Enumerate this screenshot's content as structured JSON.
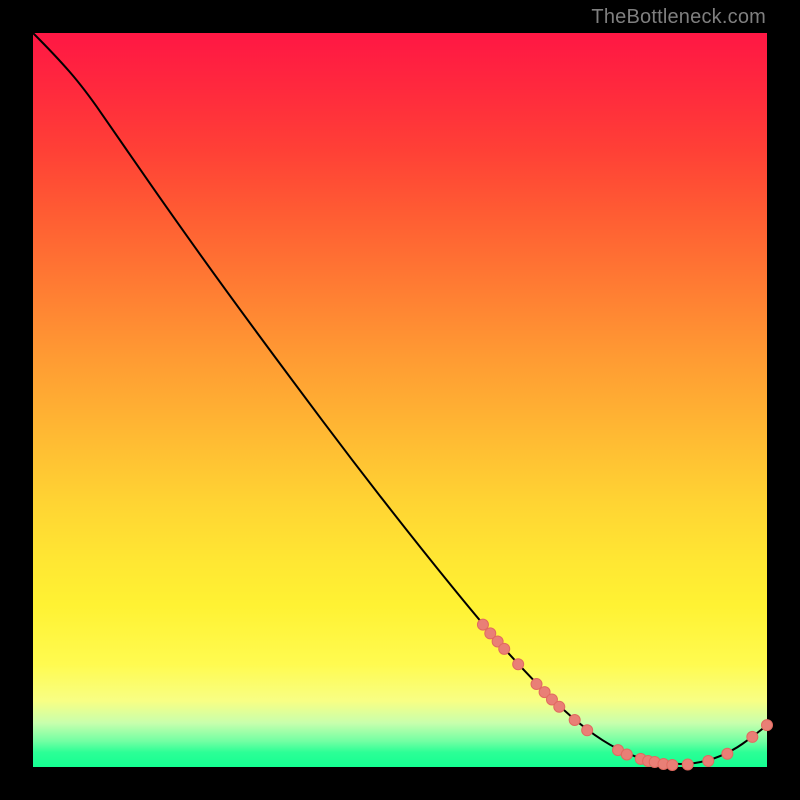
{
  "attribution": "TheBottleneck.com",
  "colors": {
    "dot_fill": "#e97f76",
    "dot_stroke": "#e16a60",
    "curve": "#000000"
  },
  "chart_data": {
    "type": "line",
    "title": "",
    "xlabel": "",
    "ylabel": "",
    "xlim": [
      0,
      100
    ],
    "ylim": [
      0,
      100
    ],
    "grid": false,
    "series": [
      {
        "name": "curve",
        "points": [
          {
            "x": 0.0,
            "y": 100.0
          },
          {
            "x": 3.0,
            "y": 97.0
          },
          {
            "x": 7.0,
            "y": 92.4
          },
          {
            "x": 11.5,
            "y": 85.9
          },
          {
            "x": 18.0,
            "y": 76.5
          },
          {
            "x": 26.0,
            "y": 65.3
          },
          {
            "x": 35.0,
            "y": 53.1
          },
          {
            "x": 44.0,
            "y": 41.1
          },
          {
            "x": 53.0,
            "y": 29.6
          },
          {
            "x": 61.3,
            "y": 19.4
          },
          {
            "x": 66.1,
            "y": 14.0
          },
          {
            "x": 71.0,
            "y": 8.9
          },
          {
            "x": 75.5,
            "y": 5.0
          },
          {
            "x": 79.7,
            "y": 2.3
          },
          {
            "x": 83.8,
            "y": 0.82
          },
          {
            "x": 88.4,
            "y": 0.27
          },
          {
            "x": 92.0,
            "y": 0.82
          },
          {
            "x": 95.3,
            "y": 2.2
          },
          {
            "x": 98.0,
            "y": 4.1
          },
          {
            "x": 100.0,
            "y": 5.7
          }
        ]
      }
    ],
    "markers": [
      {
        "x": 61.3,
        "y": 19.4,
        "r": 5.5
      },
      {
        "x": 62.3,
        "y": 18.2,
        "r": 5.5
      },
      {
        "x": 63.3,
        "y": 17.1,
        "r": 5.5
      },
      {
        "x": 64.2,
        "y": 16.1,
        "r": 5.5
      },
      {
        "x": 66.1,
        "y": 14.0,
        "r": 5.5
      },
      {
        "x": 68.6,
        "y": 11.3,
        "r": 5.5
      },
      {
        "x": 69.7,
        "y": 10.2,
        "r": 5.5
      },
      {
        "x": 70.7,
        "y": 9.2,
        "r": 5.5
      },
      {
        "x": 71.7,
        "y": 8.2,
        "r": 5.5
      },
      {
        "x": 73.8,
        "y": 6.4,
        "r": 5.5
      },
      {
        "x": 75.5,
        "y": 5.0,
        "r": 5.5
      },
      {
        "x": 79.7,
        "y": 2.3,
        "r": 5.5
      },
      {
        "x": 80.9,
        "y": 1.7,
        "r": 5.5
      },
      {
        "x": 82.8,
        "y": 1.1,
        "r": 5.5
      },
      {
        "x": 83.8,
        "y": 0.82,
        "r": 5.5
      },
      {
        "x": 84.7,
        "y": 0.68,
        "r": 5.5
      },
      {
        "x": 85.9,
        "y": 0.41,
        "r": 5.5
      },
      {
        "x": 87.1,
        "y": 0.27,
        "r": 5.5
      },
      {
        "x": 89.2,
        "y": 0.34,
        "r": 5.5
      },
      {
        "x": 92.0,
        "y": 0.82,
        "r": 5.5
      },
      {
        "x": 94.6,
        "y": 1.8,
        "r": 5.5
      },
      {
        "x": 98.0,
        "y": 4.1,
        "r": 5.5
      },
      {
        "x": 100.0,
        "y": 5.7,
        "r": 5.5
      }
    ]
  }
}
